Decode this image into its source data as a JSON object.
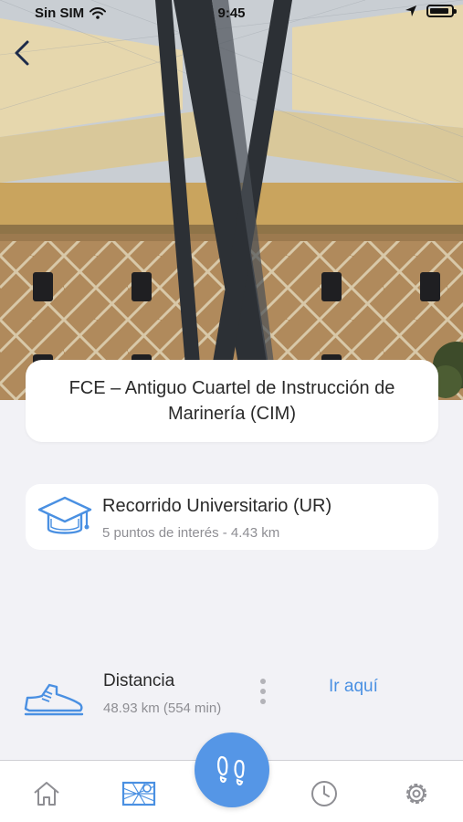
{
  "status_bar": {
    "carrier": "Sin SIM",
    "time": "9:45",
    "icons": [
      "wifi-icon",
      "location-arrow-icon",
      "battery-icon"
    ]
  },
  "header": {
    "back_icon": "chevron-left-icon",
    "hero_image": "building-photo"
  },
  "place": {
    "title": "FCE – Antiguo Cuartel de Instrucción de Marinería (CIM)"
  },
  "route": {
    "icon": "graduation-cap-icon",
    "title": "Recorrido Universitario (UR)",
    "subtitle": "5 puntos de interés - 4.43 km"
  },
  "distance": {
    "icon": "shoe-icon",
    "label": "Distancia",
    "value": "48.93 km (554 min)",
    "more_icon": "more-vertical-icon",
    "action_label": "Ir aquí"
  },
  "tab_bar": {
    "items": [
      "home-icon",
      "map-icon",
      "footsteps-icon",
      "clock-icon",
      "settings-icon"
    ],
    "active": "map-icon"
  },
  "colors": {
    "accent": "#4a90e2",
    "fab": "#5596e6",
    "background": "#f2f2f6",
    "card": "#ffffff"
  }
}
